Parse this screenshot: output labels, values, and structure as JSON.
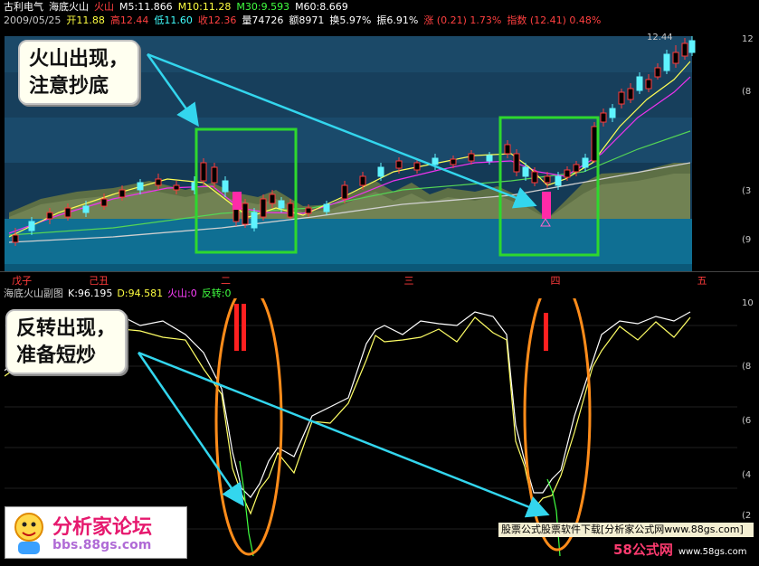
{
  "header": {
    "row1": [
      {
        "text": "古利电气",
        "color": "#ffffff"
      },
      {
        "text": "海底火山",
        "color": "#ffffff"
      },
      {
        "text": "火山",
        "color": "#ff4040"
      },
      {
        "text": "M5:11.866",
        "color": "#ffffff"
      },
      {
        "text": "M10:11.28",
        "color": "#ffff40"
      },
      {
        "text": "M30:9.593",
        "color": "#40ff40"
      },
      {
        "text": "M60:8.669",
        "color": "#ffffff"
      }
    ],
    "row2": [
      {
        "text": "2009/05/25",
        "color": "#c8c8c8"
      },
      {
        "text": "开11.88",
        "color": "#ffff40"
      },
      {
        "text": "高12.44",
        "color": "#ff4040"
      },
      {
        "text": "低11.60",
        "color": "#40ffff"
      },
      {
        "text": "收12.36",
        "color": "#ff4040"
      },
      {
        "text": "量74726",
        "color": "#ffffff"
      },
      {
        "text": "额8971",
        "color": "#ffffff"
      },
      {
        "text": "换5.97%",
        "color": "#ffffff"
      },
      {
        "text": "振6.91%",
        "color": "#ffffff"
      },
      {
        "text": "涨 (0.21) 1.73%",
        "color": "#ff4040"
      },
      {
        "text": "指数 (12.41) 0.48%",
        "color": "#ff4040"
      }
    ],
    "top_value": "12.44"
  },
  "axis_labels": [
    {
      "text": "戊子",
      "pos": 0.01
    },
    {
      "text": "己丑",
      "pos": 0.115
    },
    {
      "text": "二",
      "pos": 0.295
    },
    {
      "text": "三",
      "pos": 0.545
    },
    {
      "text": "四",
      "pos": 0.745
    },
    {
      "text": "五",
      "pos": 0.945
    }
  ],
  "lower_header": [
    {
      "text": "海底火山副图",
      "color": "#c8c8c8"
    },
    {
      "text": "K:96.195",
      "color": "#ffffff"
    },
    {
      "text": "D:94.581",
      "color": "#ffff40"
    },
    {
      "text": "火山:0",
      "color": "#ff40ff"
    },
    {
      "text": "反转:0",
      "color": "#40ff40"
    }
  ],
  "right_scale": [
    "12",
    "(8",
    "(3",
    "(9",
    "10",
    "(8",
    "(6",
    "(4",
    "(2"
  ],
  "callouts": {
    "upper": "火山出现，\n注意抄底",
    "lower": "反转出现，\n准备短炒"
  },
  "logo": {
    "title": "分析家论坛",
    "url": "bbs.88gs.com"
  },
  "banner": "股票公式股票软件下载[分析家公式网www.88gs.com]",
  "watermark": {
    "brand": "58公式网",
    "url": "www.58gs.com"
  },
  "colors": {
    "background": "#000000",
    "band_top": "#1a4a6b",
    "band_mid": "#174060",
    "mountain": "#5b6e44",
    "highlight_box": "#2ed82e",
    "ellipse": "#ff8c1a",
    "arrow": "#33d6ee",
    "candle_up": "#ff3b3b",
    "candle_down": "#5ff3ff"
  }
}
